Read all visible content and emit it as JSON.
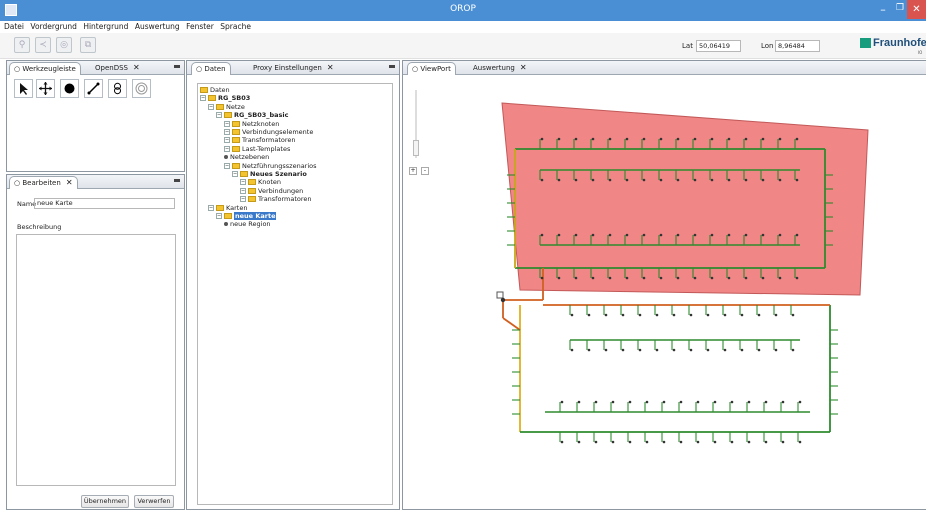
{
  "window": {
    "title": "OROP"
  },
  "menu": [
    "Datei",
    "Vordergrund",
    "Hintergrund",
    "Auswertung",
    "Fenster",
    "Sprache"
  ],
  "coords": {
    "lat_label": "Lat",
    "lat_value": "50,06419",
    "lon_label": "Lon",
    "lon_value": "8,96484"
  },
  "logo": {
    "text": "Fraunhofe",
    "sub": "IO"
  },
  "tools_panel": {
    "tabs": [
      "Werkzeugleiste",
      "OpenDSS"
    ]
  },
  "edit_panel": {
    "tab": "Bearbeiten",
    "name_label": "Name",
    "name_value": "neue Karte",
    "desc_label": "Beschreibung",
    "apply_button": "Übernehmen",
    "discard_button": "Verwerfen"
  },
  "data_panel": {
    "tabs": [
      "Daten",
      "Proxy Einstellungen"
    ],
    "tree": [
      {
        "label": "Daten",
        "level": 0,
        "type": "folder",
        "bold": false
      },
      {
        "label": "RG_SB03",
        "level": 0,
        "type": "folder",
        "bold": true
      },
      {
        "label": "Netze",
        "level": 1,
        "type": "folder",
        "bold": false
      },
      {
        "label": "RG_SB03_basic",
        "level": 2,
        "type": "folder",
        "bold": true
      },
      {
        "label": "Netzknoten",
        "level": 3,
        "type": "folder",
        "bold": false
      },
      {
        "label": "Verbindungselemente",
        "level": 3,
        "type": "folder",
        "bold": false
      },
      {
        "label": "Transformatoren",
        "level": 3,
        "type": "folder",
        "bold": false
      },
      {
        "label": "Last-Templates",
        "level": 3,
        "type": "folder",
        "bold": false
      },
      {
        "label": "Netzebenen",
        "level": 3,
        "type": "bullet",
        "bold": false
      },
      {
        "label": "Netzführungsszenarios",
        "level": 3,
        "type": "folder",
        "bold": false
      },
      {
        "label": "Neues Szenario",
        "level": 4,
        "type": "folder",
        "bold": true
      },
      {
        "label": "Knoten",
        "level": 5,
        "type": "folder",
        "bold": false
      },
      {
        "label": "Verbindungen",
        "level": 5,
        "type": "folder",
        "bold": false
      },
      {
        "label": "Transformatoren",
        "level": 5,
        "type": "folder",
        "bold": false
      },
      {
        "label": "Karten",
        "level": 1,
        "type": "folder",
        "bold": false
      },
      {
        "label": "neue Karte",
        "level": 2,
        "type": "folder",
        "bold": true,
        "selected": true
      },
      {
        "label": "neue Region",
        "level": 3,
        "type": "bullet",
        "bold": false
      }
    ]
  },
  "map_panel": {
    "tabs": [
      "ViewPort",
      "Auswertung"
    ],
    "zoom_in": "+",
    "zoom_out": "-",
    "region_color": "#f08080",
    "network_color": "#2e8b2e"
  }
}
